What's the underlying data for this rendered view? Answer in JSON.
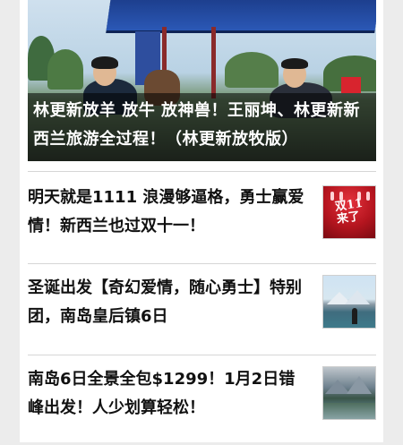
{
  "hero": {
    "caption": "林更新放羊 放牛 放神兽！王丽坤、林更新新西兰旅游全过程！（林更新放牧版）"
  },
  "articles": [
    {
      "title": "明天就是1111 浪漫够逼格，勇士赢爱情！新西兰也过双十一！",
      "thumb_text": "双11来了"
    },
    {
      "title": "圣诞出发【奇幻爱情，随心勇士】特别团，南岛皇后镇6日"
    },
    {
      "title": "南岛6日全景全包$1299！1月2日错峰出发！人少划算轻松！"
    }
  ]
}
